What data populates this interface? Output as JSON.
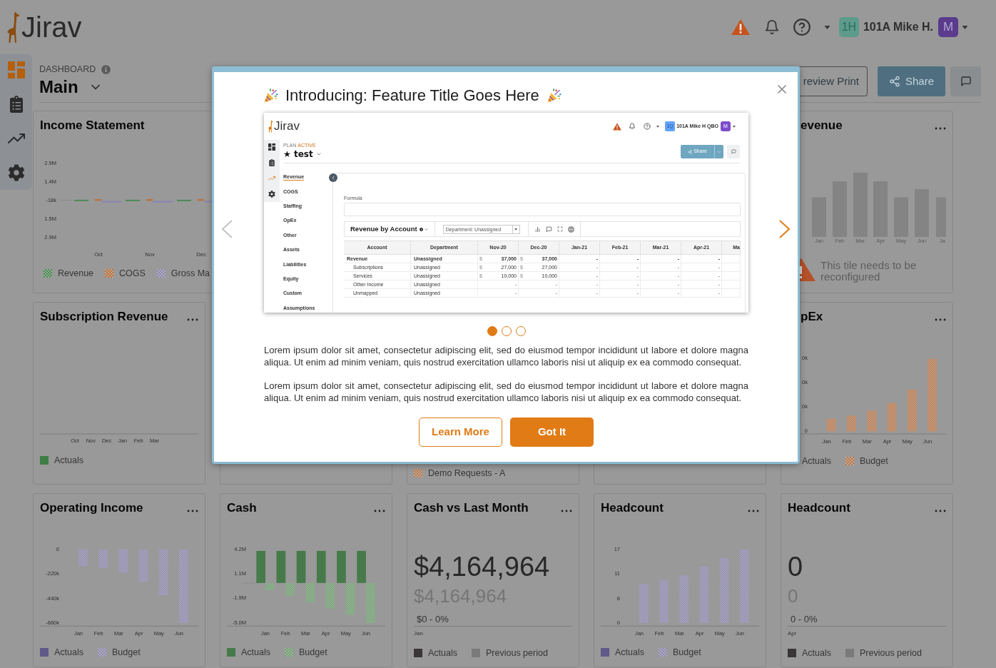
{
  "header": {
    "logo": "Jirav",
    "account_badge": "1H",
    "account_name": "101A Mike H.",
    "avatar": "M"
  },
  "sidebar": [
    {
      "selected": true
    },
    {
      "selected": false
    },
    {
      "selected": false
    },
    {
      "selected": false
    }
  ],
  "dashboard": {
    "eyebrow": "DASHBOARD",
    "title": "Main",
    "actions": [
      {
        "kind": "outline",
        "label": "review Print"
      },
      {
        "kind": "primary",
        "label": "Share"
      },
      {
        "kind": "comment"
      }
    ]
  },
  "tiles": [
    {
      "kind": "mini_bars",
      "title": "Income Statement",
      "y_labels": [
        "2.9M",
        "1.4M",
        "-18k",
        "1.5M",
        "2.9M"
      ],
      "x_labels": [
        "Oct",
        "Nov",
        "Dec"
      ],
      "legend": [
        {
          "kind": "hatched",
          "label": "Revenue",
          "color": "#4d8a55"
        },
        {
          "kind": "hatched",
          "label": "COGS",
          "color": "#b8733f"
        },
        {
          "kind": "hatched",
          "label": "Gross Ma",
          "color": "#8d88ad"
        }
      ]
    },
    {
      "kind": "placeholder",
      "title": "evenue",
      "menu": true,
      "x_labels": [
        "Jan",
        "Feb",
        "Mar",
        "Apr",
        "May",
        "Jun",
        "Ja"
      ],
      "message": "This tile needs to be reconfigured"
    },
    {
      "kind": "empty_chart",
      "title": "Subscription Revenue",
      "menu": true,
      "x_labels": [
        "Oct",
        "Nov",
        "Dec",
        "Jan",
        "Feb",
        "Mar"
      ],
      "legend": [
        {
          "kind": "solid",
          "label": "Actuals",
          "color": "#3f7d47"
        }
      ]
    },
    {
      "kind": "covered"
    },
    {
      "kind": "covered",
      "legend": [
        {
          "kind": "hatched",
          "label": "Demo Requests - A",
          "color": "#b57b52"
        }
      ]
    },
    {
      "kind": "covered"
    },
    {
      "kind": "bars_picture",
      "title": "pEx",
      "menu": true,
      "y_labels": [
        "0k",
        "0k",
        "0k",
        "0"
      ],
      "x_labels": [
        "Jan",
        "Feb",
        "Mar",
        "Apr",
        "May",
        "Jun"
      ],
      "legend": [
        {
          "kind": "covered",
          "label": "Actuals"
        },
        {
          "kind": "hatched",
          "label": "Budget",
          "color": "#b9794e"
        }
      ]
    },
    {
      "kind": "chart",
      "title": "Operating Income",
      "menu": true,
      "series_styles": [
        {
          "kind": "solid"
        },
        {
          "kind": "hatched"
        }
      ],
      "chart_data": {
        "type": "bar",
        "categories": [
          "Jan",
          "Feb",
          "Mar",
          "Apr",
          "May",
          "Jun"
        ],
        "series": [
          {
            "name": "Actuals",
            "color": "#5f5a87",
            "values": [
              null,
              null,
              null,
              null,
              null,
              null
            ]
          },
          {
            "name": "Budget",
            "color": "#8d88ad",
            "values": [
              -150000,
              -170000,
              -210000,
              -290000,
              -410000,
              -660000
            ]
          }
        ],
        "ylim": [
          -660000,
          0
        ],
        "yticks": [
          {
            "value": 0,
            "label": "0"
          },
          {
            "value": -220000,
            "label": "-220k"
          },
          {
            "value": -440000,
            "label": "-440k"
          },
          {
            "value": -660000,
            "label": "-660k"
          }
        ]
      }
    },
    {
      "kind": "chart",
      "title": "Cash",
      "menu": true,
      "series_styles": [
        {
          "kind": "solid"
        },
        {
          "kind": "hatched"
        }
      ],
      "chart_data": {
        "type": "bar",
        "categories": [
          "Jan",
          "Feb",
          "Mar",
          "Apr",
          "May",
          "Jun"
        ],
        "series": [
          {
            "name": "Actuals",
            "color": "#467a4a",
            "values": [
              4000000,
              4000000,
              4000000,
              4000000,
              4000000,
              4000000
            ]
          },
          {
            "name": "Budget",
            "color": "#6f9e6f",
            "values": [
              -900000,
              -1600000,
              -2400000,
              -3200000,
              -4000000,
              -5000000
            ]
          }
        ],
        "ylim": [
          -5000000,
          4200000
        ],
        "yticks": [
          {
            "value": 4200000,
            "label": "4.2M"
          },
          {
            "value": 1100000,
            "label": "1.1M"
          },
          {
            "value": -1900000,
            "label": "-1.9M"
          },
          {
            "value": -5000000,
            "label": "-5.0M"
          }
        ]
      }
    },
    {
      "kind": "kpi",
      "title": "Cash vs Last Month",
      "menu": true,
      "value": "$4,164,964",
      "previous": "$4,164,964",
      "change": "$0 - 0%",
      "period": "Jan",
      "legend": [
        {
          "kind": "solid",
          "label": "Actuals",
          "color": "#3a3638"
        },
        {
          "kind": "solid",
          "label": "Previous period",
          "color": "#7a7a7a"
        }
      ]
    },
    {
      "kind": "chart",
      "title": "Headcount",
      "menu": true,
      "series_styles": [
        {
          "kind": "solid"
        },
        {
          "kind": "hatched"
        }
      ],
      "chart_data": {
        "type": "bar",
        "categories": [
          "Jan",
          "Feb",
          "Mar",
          "Apr",
          "May",
          "Jun"
        ],
        "series": [
          {
            "name": "Actuals",
            "color": "#5f5a87",
            "values": [
              null,
              null,
              null,
              null,
              null,
              null
            ]
          },
          {
            "name": "Budget",
            "color": "#8d88ad",
            "values": [
              9,
              10,
              11,
              13,
              15,
              17
            ]
          }
        ],
        "ylim": [
          0,
          17
        ],
        "yticks": [
          {
            "value": 0,
            "label": "0"
          },
          {
            "value": 5.67,
            "label": "6"
          },
          {
            "value": 11.33,
            "label": "11"
          },
          {
            "value": 17,
            "label": "17"
          }
        ]
      }
    },
    {
      "kind": "kpi",
      "title": "Headcount",
      "menu": true,
      "value": "0",
      "previous": "0",
      "change": "0 - 0%",
      "period": "Apr",
      "legend": [
        {
          "kind": "solid",
          "label": "Actuals",
          "color": "#3a3638"
        },
        {
          "kind": "solid",
          "label": "Previous period",
          "color": "#7a7a7a"
        }
      ]
    }
  ],
  "modal": {
    "title": "Introducing: Feature Title Goes Here",
    "nav": [
      {
        "disabled": true
      },
      {
        "disabled": false
      }
    ],
    "slides": [
      {
        "selected": true
      },
      {
        "selected": false
      },
      {
        "selected": false
      }
    ],
    "preview": {
      "logo": "Jirav",
      "account_badge": "1Q",
      "account_name": "101A Mike H QBO",
      "avatar": "M",
      "sidebar": [
        {
          "selected": false
        },
        {
          "selected": false
        },
        {
          "selected": true
        },
        {
          "selected": false
        }
      ],
      "plan_label": "PLAN",
      "plan_status": "ACTIVE",
      "plan_name": "★ test",
      "share": "Share",
      "menu": [
        {
          "label": "Revenue",
          "selected": true
        },
        {
          "label": "COGS",
          "selected": false
        },
        {
          "label": "Staffing",
          "selected": false
        },
        {
          "label": "OpEx",
          "selected": false
        },
        {
          "label": "Other",
          "selected": false
        },
        {
          "label": "Assets",
          "selected": false
        },
        {
          "label": "Liabilities",
          "selected": false
        },
        {
          "label": "Equity",
          "selected": false
        },
        {
          "label": "Custom",
          "selected": false
        },
        {
          "label": "Assumptions",
          "selected": false
        }
      ],
      "formula_label": "Formula",
      "report_title": "Revenue by Account",
      "filter": "Department: Unassigned",
      "table": {
        "columns": [
          "Account",
          "Department",
          "Nov-20",
          "Dec-20",
          "Jan-21",
          "Feb-21",
          "Mar-21",
          "Apr-21",
          "Ma"
        ],
        "rows": [
          {
            "cells": [
              {
                "value": "Revenue"
              },
              {
                "value": "Unassigned"
              },
              {
                "currency": "$",
                "value": "37,000"
              },
              {
                "currency": "$",
                "value": "37,000"
              },
              {
                "value": "-"
              },
              {
                "value": "-"
              },
              {
                "value": "-"
              },
              {
                "value": "-"
              }
            ],
            "children": [
              {
                "cells": [
                  {
                    "value": "Subscriptions"
                  },
                  {
                    "value": "Unassigned"
                  },
                  {
                    "currency": "$",
                    "value": "27,000"
                  },
                  {
                    "currency": "$",
                    "value": "27,000"
                  },
                  {
                    "value": "-"
                  },
                  {
                    "value": "-"
                  },
                  {
                    "value": "-"
                  },
                  {
                    "value": "-"
                  }
                ]
              },
              {
                "cells": [
                  {
                    "value": "Services"
                  },
                  {
                    "value": "Unassigned"
                  },
                  {
                    "currency": "$",
                    "value": "10,000"
                  },
                  {
                    "currency": "$",
                    "value": "10,000"
                  },
                  {
                    "value": "-"
                  },
                  {
                    "value": "-"
                  },
                  {
                    "value": "-"
                  },
                  {
                    "value": "-"
                  }
                ]
              },
              {
                "cells": [
                  {
                    "value": "Other Income"
                  },
                  {
                    "value": "Unassigned"
                  },
                  {
                    "value": "-"
                  },
                  {
                    "value": "-"
                  },
                  {
                    "value": "-"
                  },
                  {
                    "value": "-"
                  },
                  {
                    "value": "-"
                  },
                  {
                    "value": "-"
                  }
                ]
              },
              {
                "cells": [
                  {
                    "value": "Unmapped"
                  },
                  {
                    "value": "Unassigned"
                  },
                  {
                    "value": "-"
                  },
                  {
                    "value": "-"
                  },
                  {
                    "value": "-"
                  },
                  {
                    "value": "-"
                  },
                  {
                    "value": "-"
                  },
                  {
                    "value": "-"
                  }
                ]
              }
            ]
          }
        ]
      }
    },
    "paragraphs": [
      "Lorem ipsum dolor sit amet, consectetur adipiscing elit, sed do eiusmod tempor incididunt ut labore et dolore magna aliqua. Ut enim ad minim veniam, quis nostrud exercitation ullamco laboris nisi ut aliquip ex ea commodo consequat.",
      "Lorem ipsum dolor sit amet, consectetur adipiscing elit, sed do eiusmod tempor incididunt ut labore et dolore magna aliqua. Ut enim ad minim veniam, quis nostrud exercitation ullamco laboris nisi ut aliquip ex ea commodo consequat."
    ],
    "buttons": [
      {
        "kind": "secondary",
        "label": "Learn More"
      },
      {
        "kind": "primary",
        "label": "Got It"
      }
    ]
  }
}
